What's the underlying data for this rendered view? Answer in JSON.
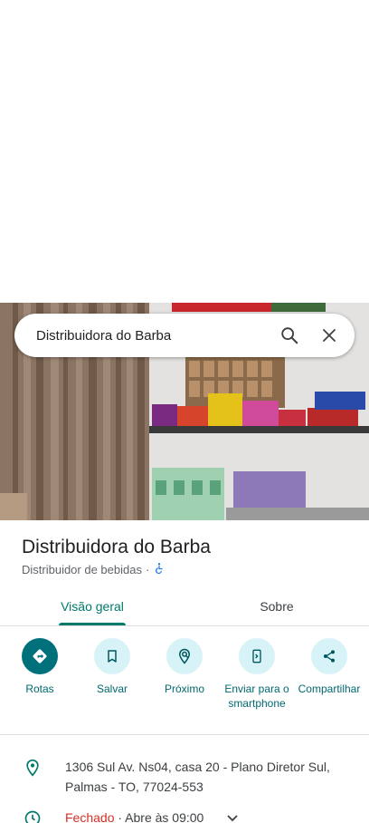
{
  "search": {
    "query": "Distribuidora do Barba"
  },
  "place": {
    "name": "Distribuidora do Barba",
    "category": "Distribuidor de bebidas",
    "separator": "·"
  },
  "tabs": [
    {
      "label": "Visão geral",
      "active": true
    },
    {
      "label": "Sobre",
      "active": false
    }
  ],
  "actions": [
    {
      "label": "Rotas",
      "icon": "directions-icon"
    },
    {
      "label": "Salvar",
      "icon": "bookmark-icon"
    },
    {
      "label": "Próximo",
      "icon": "nearby-icon"
    },
    {
      "label": "Enviar para o smartphone",
      "icon": "send-to-phone-icon"
    },
    {
      "label": "Compartilhar",
      "icon": "share-icon"
    }
  ],
  "info": {
    "address_line1": "1306 Sul Av. Ns04, casa 20 - Plano Diretor Sul,",
    "address_line2": "Palmas - TO, 77024-553",
    "status": "Fechado",
    "hours": " · Abre às 09:00"
  },
  "colors": {
    "accent": "#00796b",
    "closed": "#d93025",
    "action_bg": "#d7f3f7"
  }
}
